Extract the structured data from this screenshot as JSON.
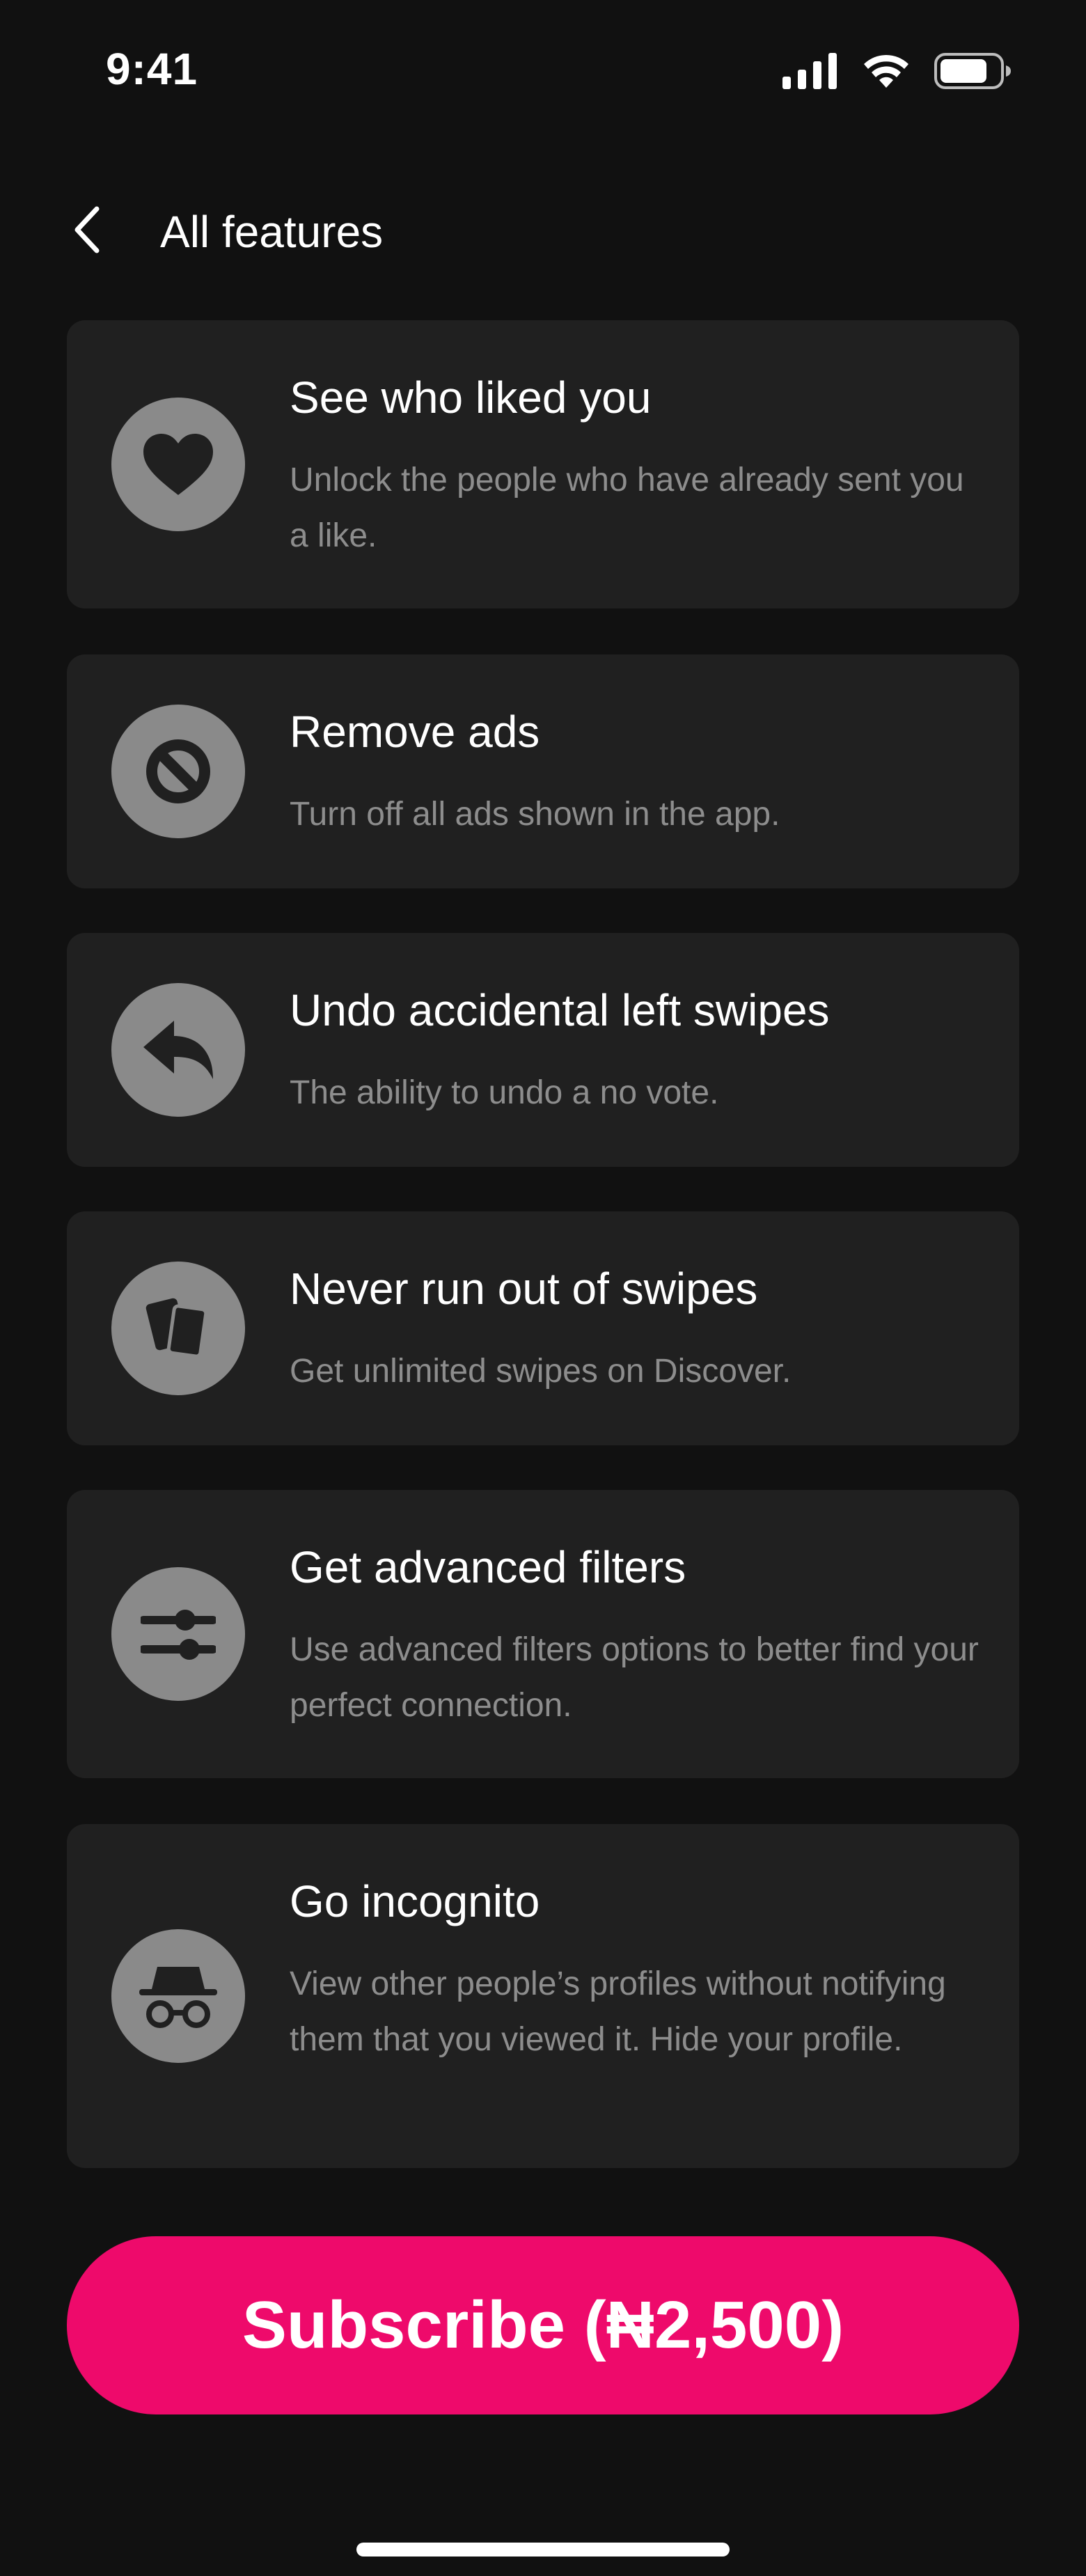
{
  "status_bar": {
    "time": "9:41",
    "icons": [
      "signal-icon",
      "wifi-icon",
      "battery-icon"
    ]
  },
  "header": {
    "back_icon": "chevron-left-icon",
    "title": "All features"
  },
  "features": [
    {
      "icon": "heart-icon",
      "title": "See who liked you",
      "description": "Unlock the people who have already sent you a like."
    },
    {
      "icon": "block-icon",
      "title": "Remove ads",
      "description": "Turn off all ads shown in the app."
    },
    {
      "icon": "undo-icon",
      "title": "Undo accidental left swipes",
      "description": "The ability to undo a no vote."
    },
    {
      "icon": "cards-icon",
      "title": "Never run out of swipes",
      "description": "Get unlimited swipes on Discover."
    },
    {
      "icon": "sliders-icon",
      "title": "Get advanced filters",
      "description": "Use advanced filters options to better find your perfect connection."
    },
    {
      "icon": "incognito-icon",
      "title": "Go incognito",
      "description": "View other people’s profiles without notifying them that you viewed it. Hide your profile."
    }
  ],
  "subscribe": {
    "label": "Subscribe (₦2,500)"
  },
  "colors": {
    "background": "#111111",
    "card": "#202020",
    "icon_circle": "#8a8a8a",
    "description_text": "#8d8d8d",
    "accent": "#ee0a6b"
  }
}
